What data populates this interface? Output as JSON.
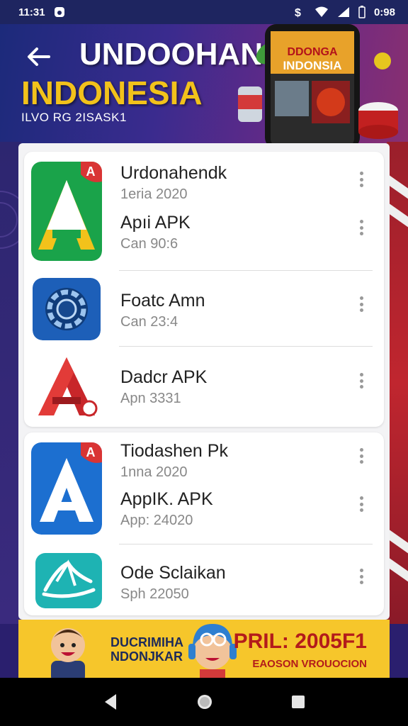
{
  "status_bar": {
    "time": "11:31",
    "battery": "0:98"
  },
  "header": {
    "title": "UNDOOHAN",
    "subtitle": "INDONESIA",
    "caption": "ILVO RG 2ISASK1",
    "promo_phone_line1": "DDONGA",
    "promo_phone_line2": "INDONSIA"
  },
  "apps": [
    {
      "name": "Urdonahendk",
      "meta": "1eria 2020",
      "icon": "letter-a-green-icon",
      "color": "#1aa34a"
    },
    {
      "name": "Apıi APK",
      "meta": "Can 90:6",
      "icon": "",
      "color": ""
    },
    {
      "name": "Foatc Amn",
      "meta": "Can 23:4",
      "icon": "gear-wheel-icon",
      "color": "#1d5fb8"
    },
    {
      "name": "Dadcr APK",
      "meta": "Apn 3331",
      "icon": "letter-a-red-icon",
      "color": "#c8262a"
    },
    {
      "name": "Tiodashen Pk",
      "meta": "1nna 2020",
      "icon": "letter-a-blue-icon",
      "color": "#1c6fd0"
    },
    {
      "name": "AppIK. APK",
      "meta": "App: 24020",
      "icon": "",
      "color": ""
    },
    {
      "name": "Ode Sclaikan",
      "meta": "Sph 22050",
      "icon": "boat-icon",
      "color": "#1eb3b3"
    }
  ],
  "banner": {
    "left_line1": "DUCRIMIHA",
    "left_line2": "NDONJKAR",
    "right_top": "PRIL: 2005F1",
    "right_bottom": "EAOSON VROUOCION"
  }
}
